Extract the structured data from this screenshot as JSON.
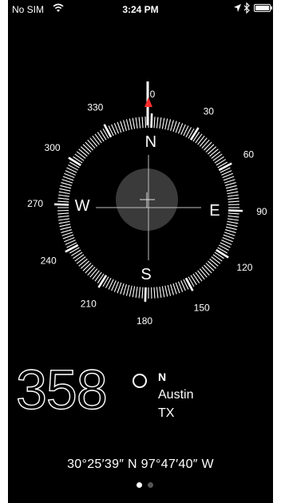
{
  "status_bar": {
    "carrier": "No SIM",
    "time": "3:24 PM",
    "icons": [
      "wifi-icon",
      "location-arrow-icon",
      "bluetooth-icon",
      "battery-icon"
    ]
  },
  "compass": {
    "heading_degrees": 358,
    "cardinals": {
      "north": "N",
      "east": "E",
      "south": "S",
      "west": "W"
    },
    "degree_labels": [
      "0",
      "30",
      "60",
      "90",
      "120",
      "150",
      "180",
      "210",
      "240",
      "270",
      "300",
      "330"
    ],
    "colors": {
      "background": "#000000",
      "ticks": "#ffffff",
      "north_marker": "#ff2d2d",
      "level_disc": "#3a3a3a"
    }
  },
  "readout": {
    "heading": "358",
    "direction": "N",
    "city": "Austin",
    "state": "TX",
    "coordinates": "30°25′39″ N  97°47′40″ W"
  },
  "page_indicator": {
    "total": 2,
    "active": 0
  }
}
